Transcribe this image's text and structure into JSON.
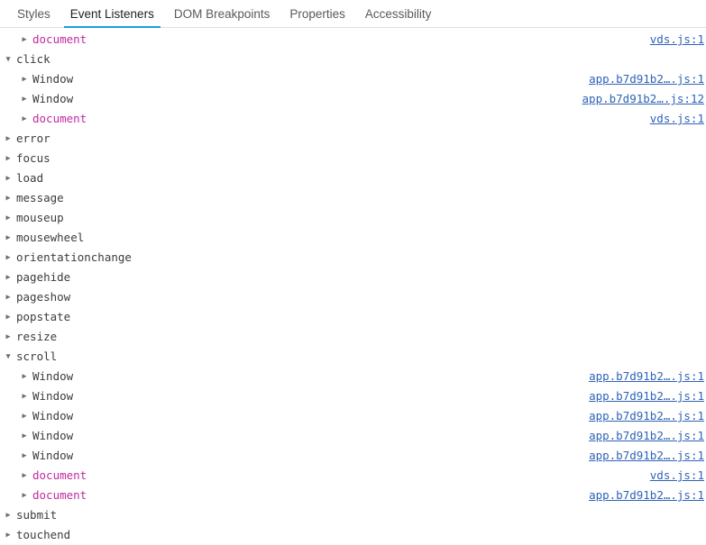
{
  "tabs": [
    {
      "label": "Styles",
      "active": false
    },
    {
      "label": "Event Listeners",
      "active": true
    },
    {
      "label": "DOM Breakpoints",
      "active": false
    },
    {
      "label": "Properties",
      "active": false
    },
    {
      "label": "Accessibility",
      "active": false
    }
  ],
  "colors": {
    "active_tab_underline": "#1a9fe0",
    "document_node": "#c02ba0",
    "source_link": "#2e63b8",
    "node_text": "#3c3c3c",
    "background": "#ffffff"
  },
  "icons": {
    "collapsed": "▶",
    "expanded": "▼",
    "collapsed_name": "triangle-right-icon",
    "expanded_name": "triangle-down-icon"
  },
  "rows": [
    {
      "level": 1,
      "state": "collapsed",
      "label": "document",
      "kind": "document",
      "link": "vds.js:1"
    },
    {
      "level": 0,
      "state": "expanded",
      "label": "click",
      "kind": "event",
      "link": ""
    },
    {
      "level": 1,
      "state": "collapsed",
      "label": "Window",
      "kind": "window",
      "link": "app.b7d91b2….js:1"
    },
    {
      "level": 1,
      "state": "collapsed",
      "label": "Window",
      "kind": "window",
      "link": "app.b7d91b2….js:12"
    },
    {
      "level": 1,
      "state": "collapsed",
      "label": "document",
      "kind": "document",
      "link": "vds.js:1"
    },
    {
      "level": 0,
      "state": "collapsed",
      "label": "error",
      "kind": "event",
      "link": ""
    },
    {
      "level": 0,
      "state": "collapsed",
      "label": "focus",
      "kind": "event",
      "link": ""
    },
    {
      "level": 0,
      "state": "collapsed",
      "label": "load",
      "kind": "event",
      "link": ""
    },
    {
      "level": 0,
      "state": "collapsed",
      "label": "message",
      "kind": "event",
      "link": ""
    },
    {
      "level": 0,
      "state": "collapsed",
      "label": "mouseup",
      "kind": "event",
      "link": ""
    },
    {
      "level": 0,
      "state": "collapsed",
      "label": "mousewheel",
      "kind": "event",
      "link": ""
    },
    {
      "level": 0,
      "state": "collapsed",
      "label": "orientationchange",
      "kind": "event",
      "link": ""
    },
    {
      "level": 0,
      "state": "collapsed",
      "label": "pagehide",
      "kind": "event",
      "link": ""
    },
    {
      "level": 0,
      "state": "collapsed",
      "label": "pageshow",
      "kind": "event",
      "link": ""
    },
    {
      "level": 0,
      "state": "collapsed",
      "label": "popstate",
      "kind": "event",
      "link": ""
    },
    {
      "level": 0,
      "state": "collapsed",
      "label": "resize",
      "kind": "event",
      "link": ""
    },
    {
      "level": 0,
      "state": "expanded",
      "label": "scroll",
      "kind": "event",
      "link": ""
    },
    {
      "level": 1,
      "state": "collapsed",
      "label": "Window",
      "kind": "window",
      "link": "app.b7d91b2….js:1"
    },
    {
      "level": 1,
      "state": "collapsed",
      "label": "Window",
      "kind": "window",
      "link": "app.b7d91b2….js:1"
    },
    {
      "level": 1,
      "state": "collapsed",
      "label": "Window",
      "kind": "window",
      "link": "app.b7d91b2….js:1"
    },
    {
      "level": 1,
      "state": "collapsed",
      "label": "Window",
      "kind": "window",
      "link": "app.b7d91b2….js:1"
    },
    {
      "level": 1,
      "state": "collapsed",
      "label": "Window",
      "kind": "window",
      "link": "app.b7d91b2….js:1"
    },
    {
      "level": 1,
      "state": "collapsed",
      "label": "document",
      "kind": "document",
      "link": "vds.js:1"
    },
    {
      "level": 1,
      "state": "collapsed",
      "label": "document",
      "kind": "document",
      "link": "app.b7d91b2….js:1"
    },
    {
      "level": 0,
      "state": "collapsed",
      "label": "submit",
      "kind": "event",
      "link": ""
    },
    {
      "level": 0,
      "state": "collapsed",
      "label": "touchend",
      "kind": "event",
      "link": ""
    }
  ]
}
